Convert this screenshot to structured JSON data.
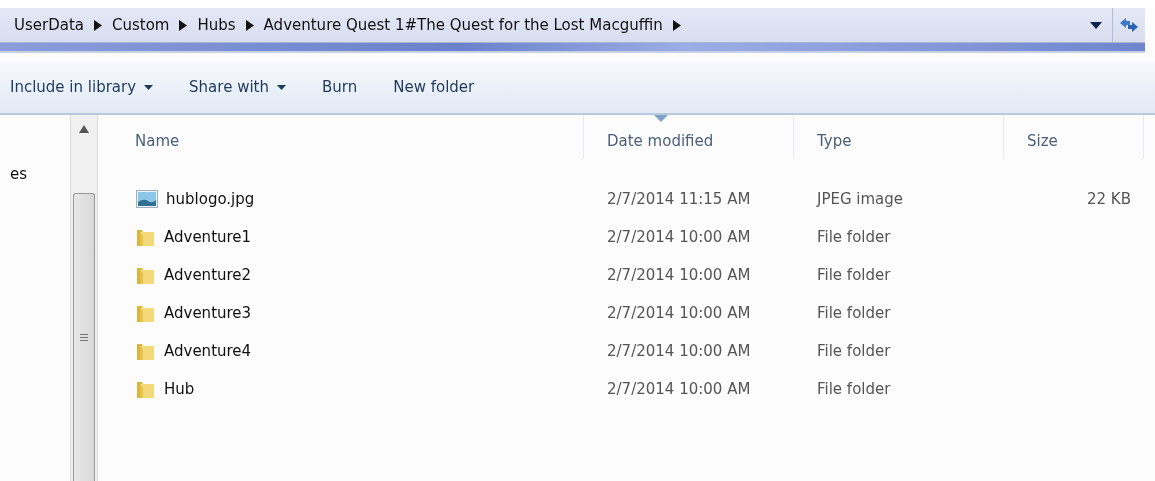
{
  "breadcrumb": [
    {
      "label": "UserData"
    },
    {
      "label": "Custom"
    },
    {
      "label": "Hubs"
    },
    {
      "label": "Adventure Quest 1#The Quest for the Lost Macguffin"
    }
  ],
  "toolbar": [
    {
      "label": "Include in library",
      "dropdown": true
    },
    {
      "label": "Share with",
      "dropdown": true
    },
    {
      "label": "Burn",
      "dropdown": false
    },
    {
      "label": "New folder",
      "dropdown": false
    }
  ],
  "nav_pane": {
    "items": [
      {
        "label": "es"
      }
    ]
  },
  "table": {
    "columns": [
      {
        "label": "Name",
        "sorted": false
      },
      {
        "label": "Date modified",
        "sorted": true
      },
      {
        "label": "Type",
        "sorted": false
      },
      {
        "label": "Size",
        "sorted": false
      }
    ],
    "rows": [
      {
        "kind": "image",
        "name": "hublogo.jpg",
        "date": "2/7/2014 11:15 AM",
        "type": "JPEG image",
        "size": "22 KB"
      },
      {
        "kind": "folder",
        "name": "Adventure1",
        "date": "2/7/2014 10:00 AM",
        "type": "File folder"
      },
      {
        "kind": "folder",
        "name": "Adventure2",
        "date": "2/7/2014 10:00 AM",
        "type": "File folder"
      },
      {
        "kind": "folder",
        "name": "Adventure3",
        "date": "2/7/2014 10:00 AM",
        "type": "File folder"
      },
      {
        "kind": "folder",
        "name": "Adventure4",
        "date": "2/7/2014 10:00 AM",
        "type": "File folder"
      },
      {
        "kind": "folder",
        "name": "Hub",
        "date": "2/7/2014 10:00 AM",
        "type": "File folder"
      }
    ]
  }
}
